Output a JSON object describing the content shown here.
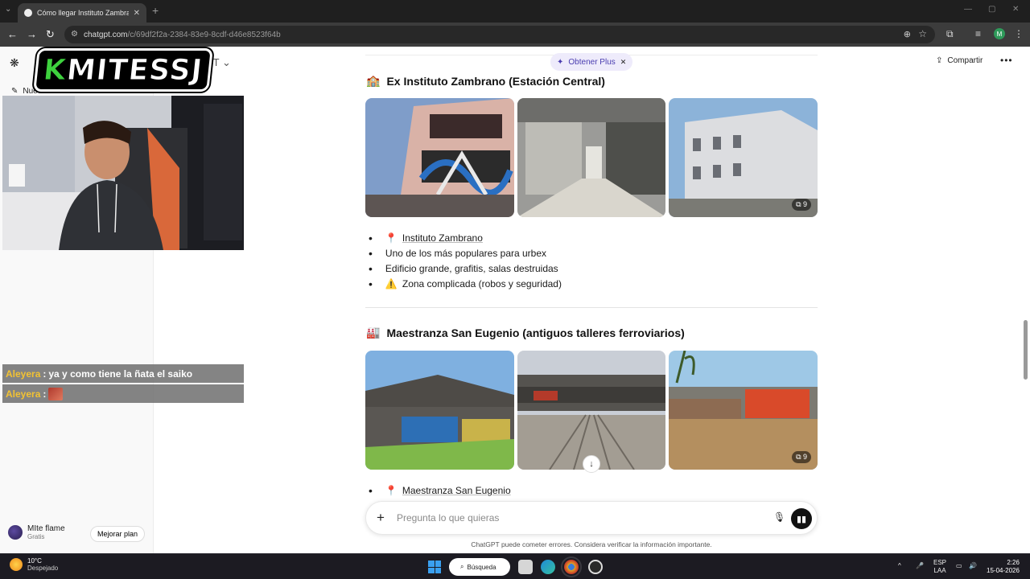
{
  "browser": {
    "tab_title": "Cómo llegar Instituto Zambrano",
    "url_domain": "chatgpt.com",
    "url_path": "/c/69df2f2a-2384-83e9-8cdf-d46e8523f64b"
  },
  "sidebar": {
    "new_chat": "Nuevo chat",
    "user_name": "MIte flame",
    "user_plan": "Gratis",
    "upgrade": "Mejorar plan"
  },
  "overlay": {
    "logo_k": "K",
    "logo_rest": "MITESSJ",
    "model_fragment": "PT",
    "chat": [
      {
        "who": "Aleyera",
        "text": "ya y como tiene la ñata el saiko"
      },
      {
        "who": "Aleyera",
        "text": ""
      }
    ]
  },
  "header": {
    "plus_pill": "Obtener Plus",
    "share": "Compartir"
  },
  "sections": [
    {
      "emoji": "🏫",
      "title": "Ex Instituto Zambrano (Estación Central)",
      "image_count": "9",
      "bullets": [
        {
          "icon": "📍",
          "text": "Instituto Zambrano",
          "link": true
        },
        {
          "icon": "",
          "text": "Uno de los más populares para urbex",
          "link": false
        },
        {
          "icon": "",
          "text": "Edificio grande, grafitis, salas destruidas",
          "link": false
        },
        {
          "icon": "⚠️",
          "text": "Zona complicada (robos y seguridad)",
          "link": false
        }
      ]
    },
    {
      "emoji": "🏭",
      "title": "Maestranza San Eugenio (antiguos talleres ferroviarios)",
      "image_count": "9",
      "bullets": [
        {
          "icon": "📍",
          "text": "Maestranza San Eugenio",
          "link": true
        }
      ]
    }
  ],
  "composer": {
    "placeholder": "Pregunta lo que quieras",
    "disclaimer": "ChatGPT puede cometer errores. Considera verificar la información importante."
  },
  "taskbar": {
    "temp": "10°C",
    "weather": "Despejado",
    "search": "Búsqueda",
    "lang1": "ESP",
    "lang2": "LAA",
    "time": "2:26",
    "date": "15-04-2026"
  }
}
